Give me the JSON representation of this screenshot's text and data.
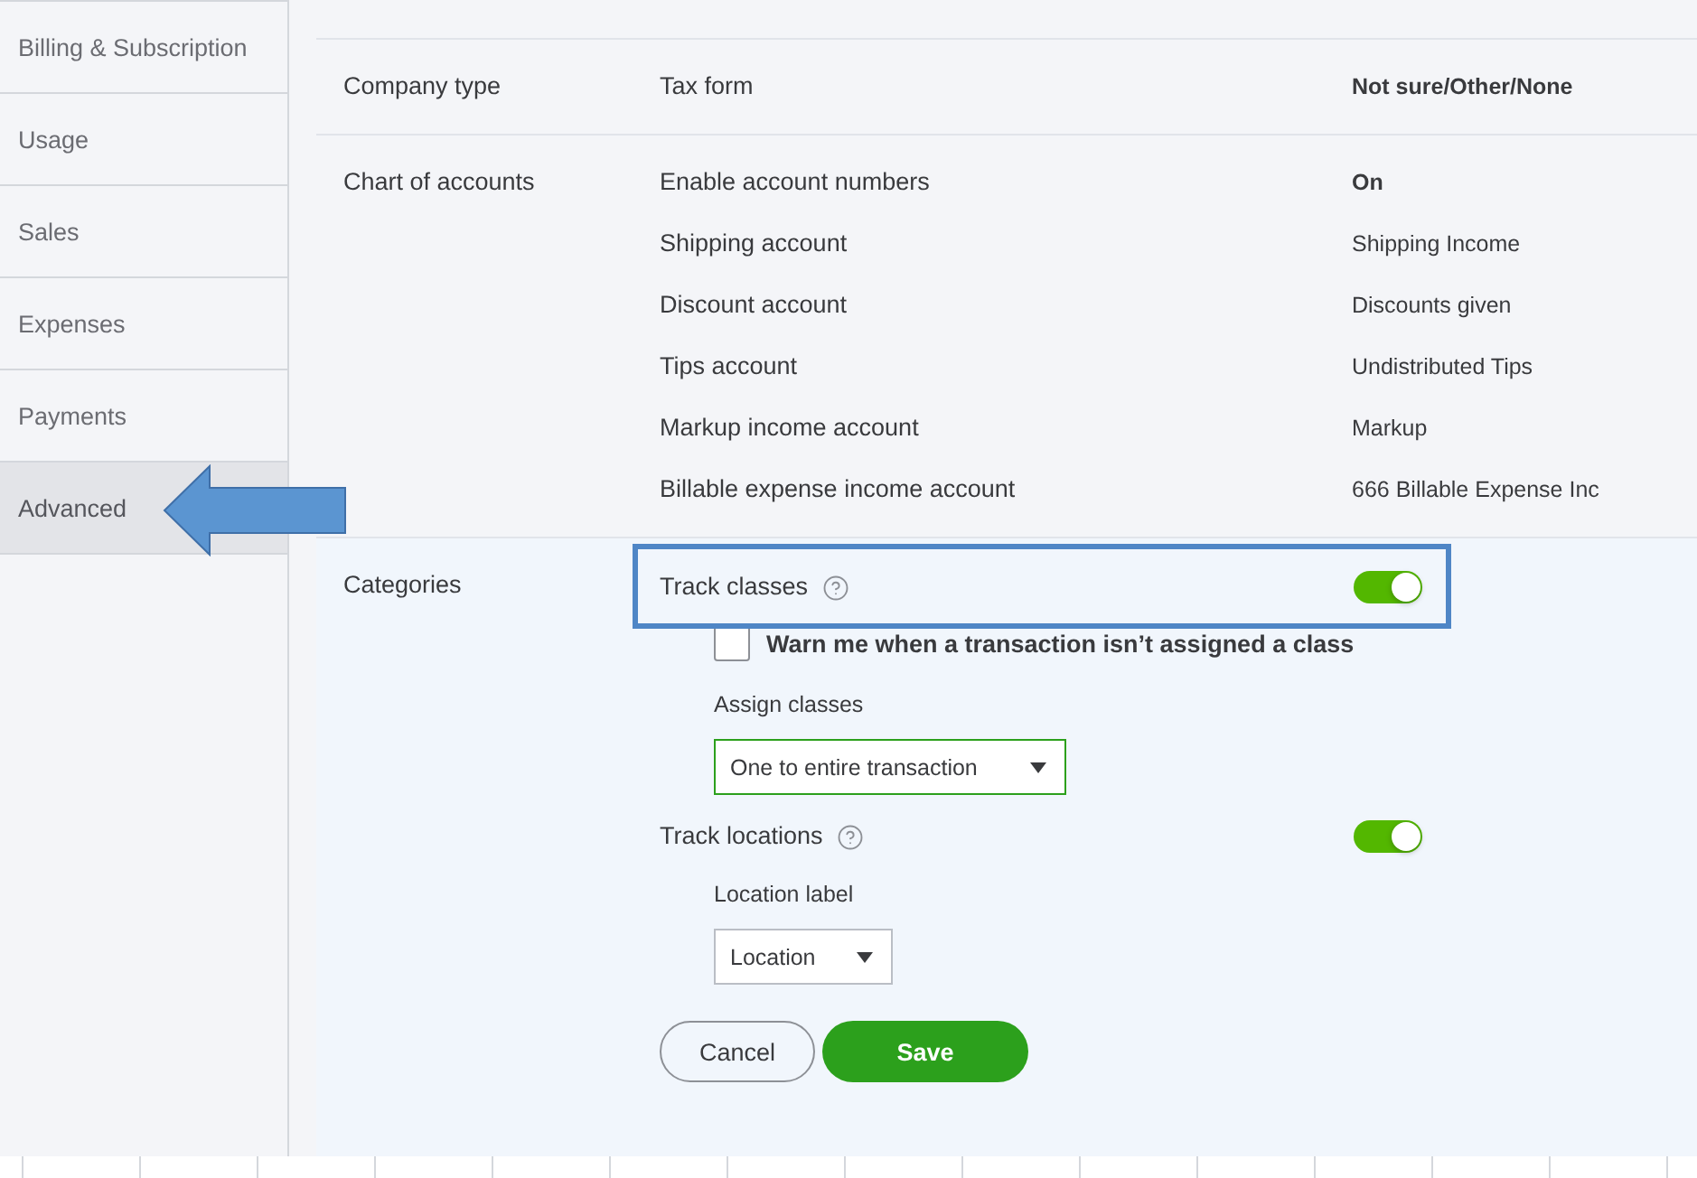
{
  "sidebar": {
    "items": [
      {
        "label": "Billing & Subscription",
        "selected": false
      },
      {
        "label": "Usage",
        "selected": false
      },
      {
        "label": "Sales",
        "selected": false
      },
      {
        "label": "Expenses",
        "selected": false
      },
      {
        "label": "Payments",
        "selected": false
      },
      {
        "label": "Advanced",
        "selected": true
      }
    ]
  },
  "sections": [
    {
      "title": "Company type",
      "settings": [
        {
          "label": "Tax form",
          "value": "Not sure/Other/None",
          "bold": true
        }
      ]
    },
    {
      "title": "Chart of accounts",
      "settings": [
        {
          "label": "Enable account numbers",
          "value": "On",
          "bold": true
        },
        {
          "label": "Shipping account",
          "value": "Shipping Income",
          "bold": false
        },
        {
          "label": "Discount account",
          "value": "Discounts given",
          "bold": false
        },
        {
          "label": "Tips account",
          "value": "Undistributed Tips",
          "bold": false
        },
        {
          "label": "Markup income account",
          "value": "Markup",
          "bold": false
        },
        {
          "label": "Billable expense income account",
          "value": "666 Billable Expense Inc ",
          "bold": false
        }
      ]
    }
  ],
  "categories": {
    "title": "Categories",
    "track_classes": {
      "label": "Track classes",
      "on": true,
      "highlighted": true
    },
    "warn_checkbox": {
      "label": "Warn me when a transaction isn’t assigned a class",
      "checked": false
    },
    "assign_classes": {
      "label": "Assign classes",
      "value": "One to entire transaction"
    },
    "track_locations": {
      "label": "Track locations",
      "on": true
    },
    "location_label": {
      "label": "Location label",
      "value": "Location"
    },
    "buttons": {
      "cancel": "Cancel",
      "save": "Save"
    }
  }
}
